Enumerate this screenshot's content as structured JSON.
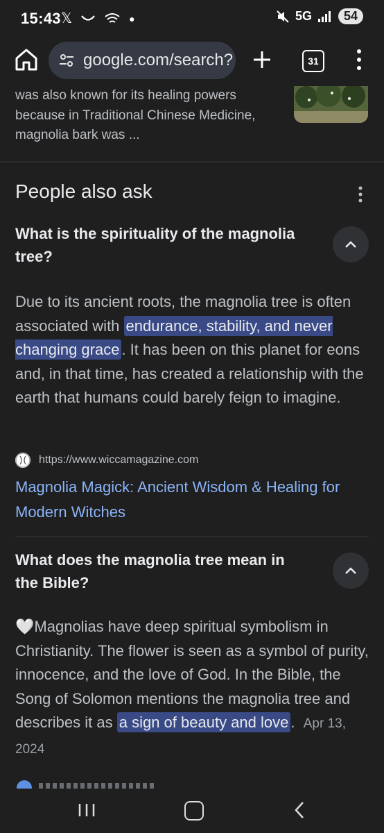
{
  "status_bar": {
    "time": "15:43",
    "network": "5G",
    "battery": "54"
  },
  "toolbar": {
    "url": "google.com/search?",
    "tab_count": "31"
  },
  "previous_result": {
    "snippet": "was also known for its healing powers because in Traditional Chinese Medicine, magnolia bark was ..."
  },
  "paa": {
    "title": "People also ask",
    "q1": {
      "question": "What is the spirituality of the magnolia tree?",
      "answer_pre": "Due to its ancient roots, the magnolia tree is often associated with ",
      "answer_highlight": "endurance, stability, and never changing grace",
      "answer_post": ". It has been on this planet for eons and, in that time, has created a relationship with the earth that humans could barely feign to imagine.",
      "source_url": "https://www.wiccamagazine.com",
      "link_title": "Magnolia Magick: Ancient Wisdom & Healing for Modern Witches"
    },
    "q2": {
      "question": "What does the magnolia tree mean in the Bible?",
      "answer_emoji": "🤍",
      "answer_pre": "Magnolias have deep spiritual symbolism in Christianity. The flower is seen as a symbol of purity, innocence, and the love of God. In the Bible, the Song of Solomon mentions the magnolia tree and describes it as ",
      "answer_highlight": "a sign of beauty and love",
      "answer_post": ".",
      "date": "Apr 13, 2024"
    }
  },
  "colors": {
    "background": "#1f1f1f",
    "highlight": "#394a87",
    "link": "#8ab4f8"
  }
}
